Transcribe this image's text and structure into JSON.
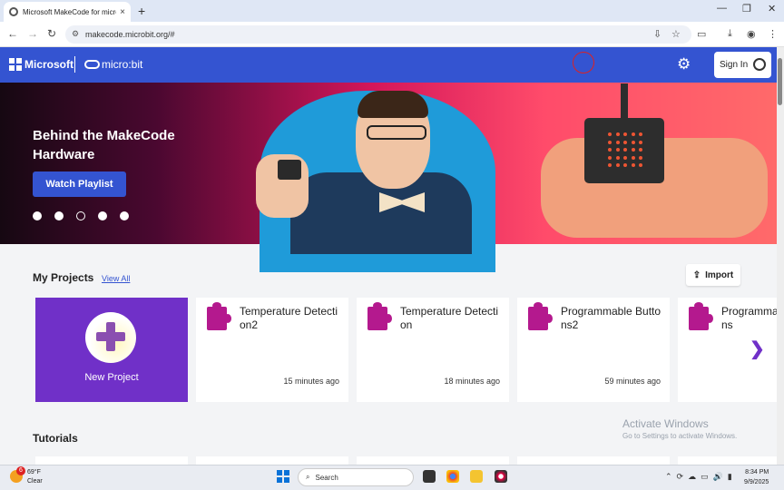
{
  "browser": {
    "tab_title": "Microsoft MakeCode for micro:bit",
    "url": "makecode.microbit.org/#",
    "new_tab": "+",
    "close_tab": "×"
  },
  "header": {
    "brand": "Microsoft",
    "product": "micro:bit",
    "signin_label": "Sign In"
  },
  "hero": {
    "title": "Behind the MakeCode Hardware",
    "button": "Watch Playlist",
    "slides": 5,
    "active_slide": 3
  },
  "projects": {
    "heading": "My Projects",
    "view_all": "View All",
    "import": "Import",
    "new_project": "New Project",
    "items": [
      {
        "name": "Temperature Detection2",
        "time": "15 minutes ago"
      },
      {
        "name": "Temperature Detection",
        "time": "18 minutes ago"
      },
      {
        "name": "Programmable Buttons2",
        "time": "59 minutes ago"
      },
      {
        "name": "Programmable Buttons",
        "time": ""
      }
    ]
  },
  "tutorials": {
    "heading": "Tutorials"
  },
  "watermark": {
    "line1": "Activate Windows",
    "line2": "Go to Settings to activate Windows."
  },
  "taskbar": {
    "temp": "69°F",
    "condition": "Clear",
    "badge": "6",
    "search": "Search",
    "time": "8:34 PM",
    "date": "9/9/2025"
  },
  "colors": {
    "accent": "#3454d1",
    "purple": "#7030c8",
    "puzzle": "#b4198e"
  }
}
